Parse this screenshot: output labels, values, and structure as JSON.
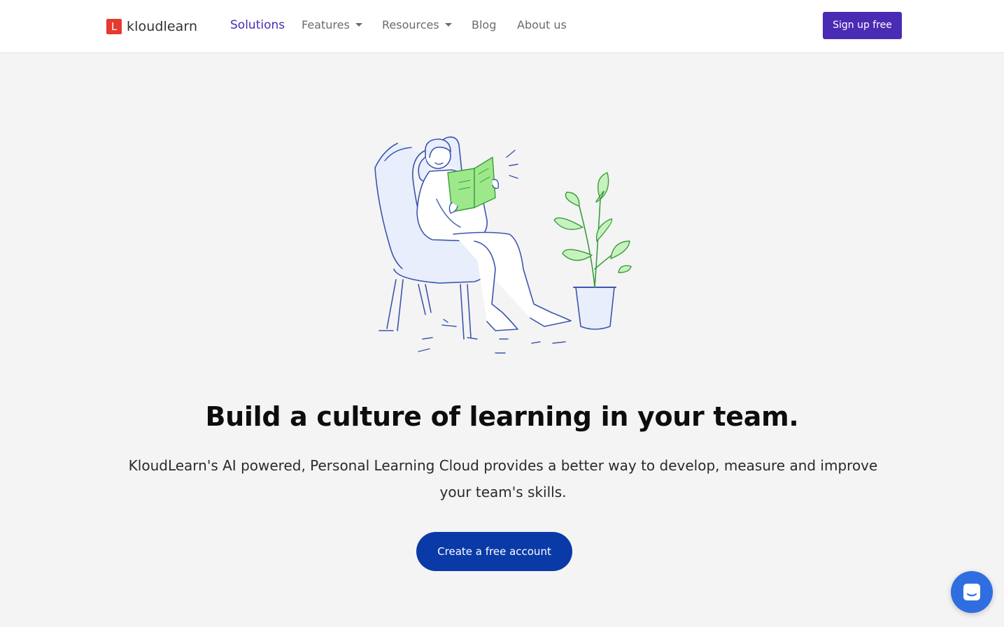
{
  "nav": {
    "logo_mark": "L",
    "logo_text": "kloudlearn",
    "items": [
      {
        "label": "Solutions",
        "active": true,
        "dropdown": false
      },
      {
        "label": "Features",
        "active": false,
        "dropdown": true
      },
      {
        "label": "Resources",
        "active": false,
        "dropdown": true
      },
      {
        "label": "Blog",
        "active": false,
        "dropdown": false
      },
      {
        "label": "About us",
        "active": false,
        "dropdown": false
      }
    ],
    "signup_label": "Sign up free"
  },
  "hero": {
    "illustration": "woman-reading-book-in-armchair-with-plant",
    "headline": "Build a culture of learning in your team.",
    "subtext": "KloudLearn's AI powered, Personal Learning Cloud provides a better way to develop, measure and improve your team's skills.",
    "cta_label": "Create a free account"
  },
  "chat": {
    "icon": "chat-bubble-icon"
  },
  "colors": {
    "brand": "#4a2bb3",
    "cta": "#0a3aa8",
    "logo_red": "#e8392f",
    "chat": "#2f6ee0",
    "background": "#f4f4f4"
  }
}
